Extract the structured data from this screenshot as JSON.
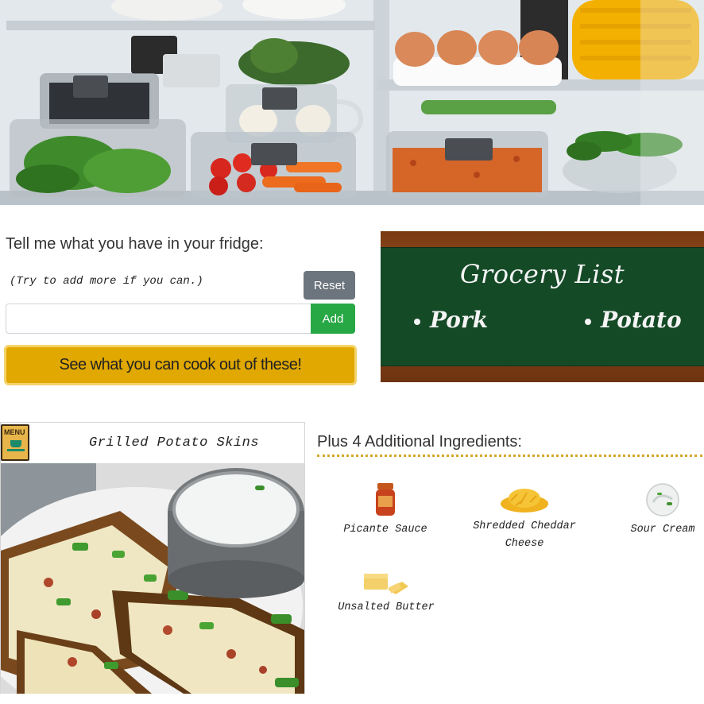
{
  "form": {
    "prompt": "Tell me what you have in your fridge:",
    "hint": "(Try to add more if you can.)",
    "reset_label": "Reset",
    "input_value": "",
    "input_placeholder": "",
    "add_label": "Add",
    "cook_label": "See what you can cook out of these!"
  },
  "grocery_list": {
    "title": "Grocery List",
    "items": [
      "Pork",
      "Potato"
    ]
  },
  "recipe": {
    "title": "Grilled Potato Skins",
    "menu_icon_text": "MENU"
  },
  "additional": {
    "heading": "Plus 4 Additional Ingredients:",
    "items": [
      {
        "name": "Picante Sauce",
        "icon": "sauce-jar-icon"
      },
      {
        "name": "Shredded Cheddar Cheese",
        "icon": "shredded-cheese-icon"
      },
      {
        "name": "Sour Cream",
        "icon": "sour-cream-icon"
      },
      {
        "name": "Unsalted Butter",
        "icon": "butter-icon"
      }
    ]
  },
  "colors": {
    "reset": "#6c757d",
    "add": "#28a745",
    "cook": "#e0a800",
    "chalkboard": "#154a27",
    "frame": "#8a4518",
    "rule": "#d4a72c"
  }
}
